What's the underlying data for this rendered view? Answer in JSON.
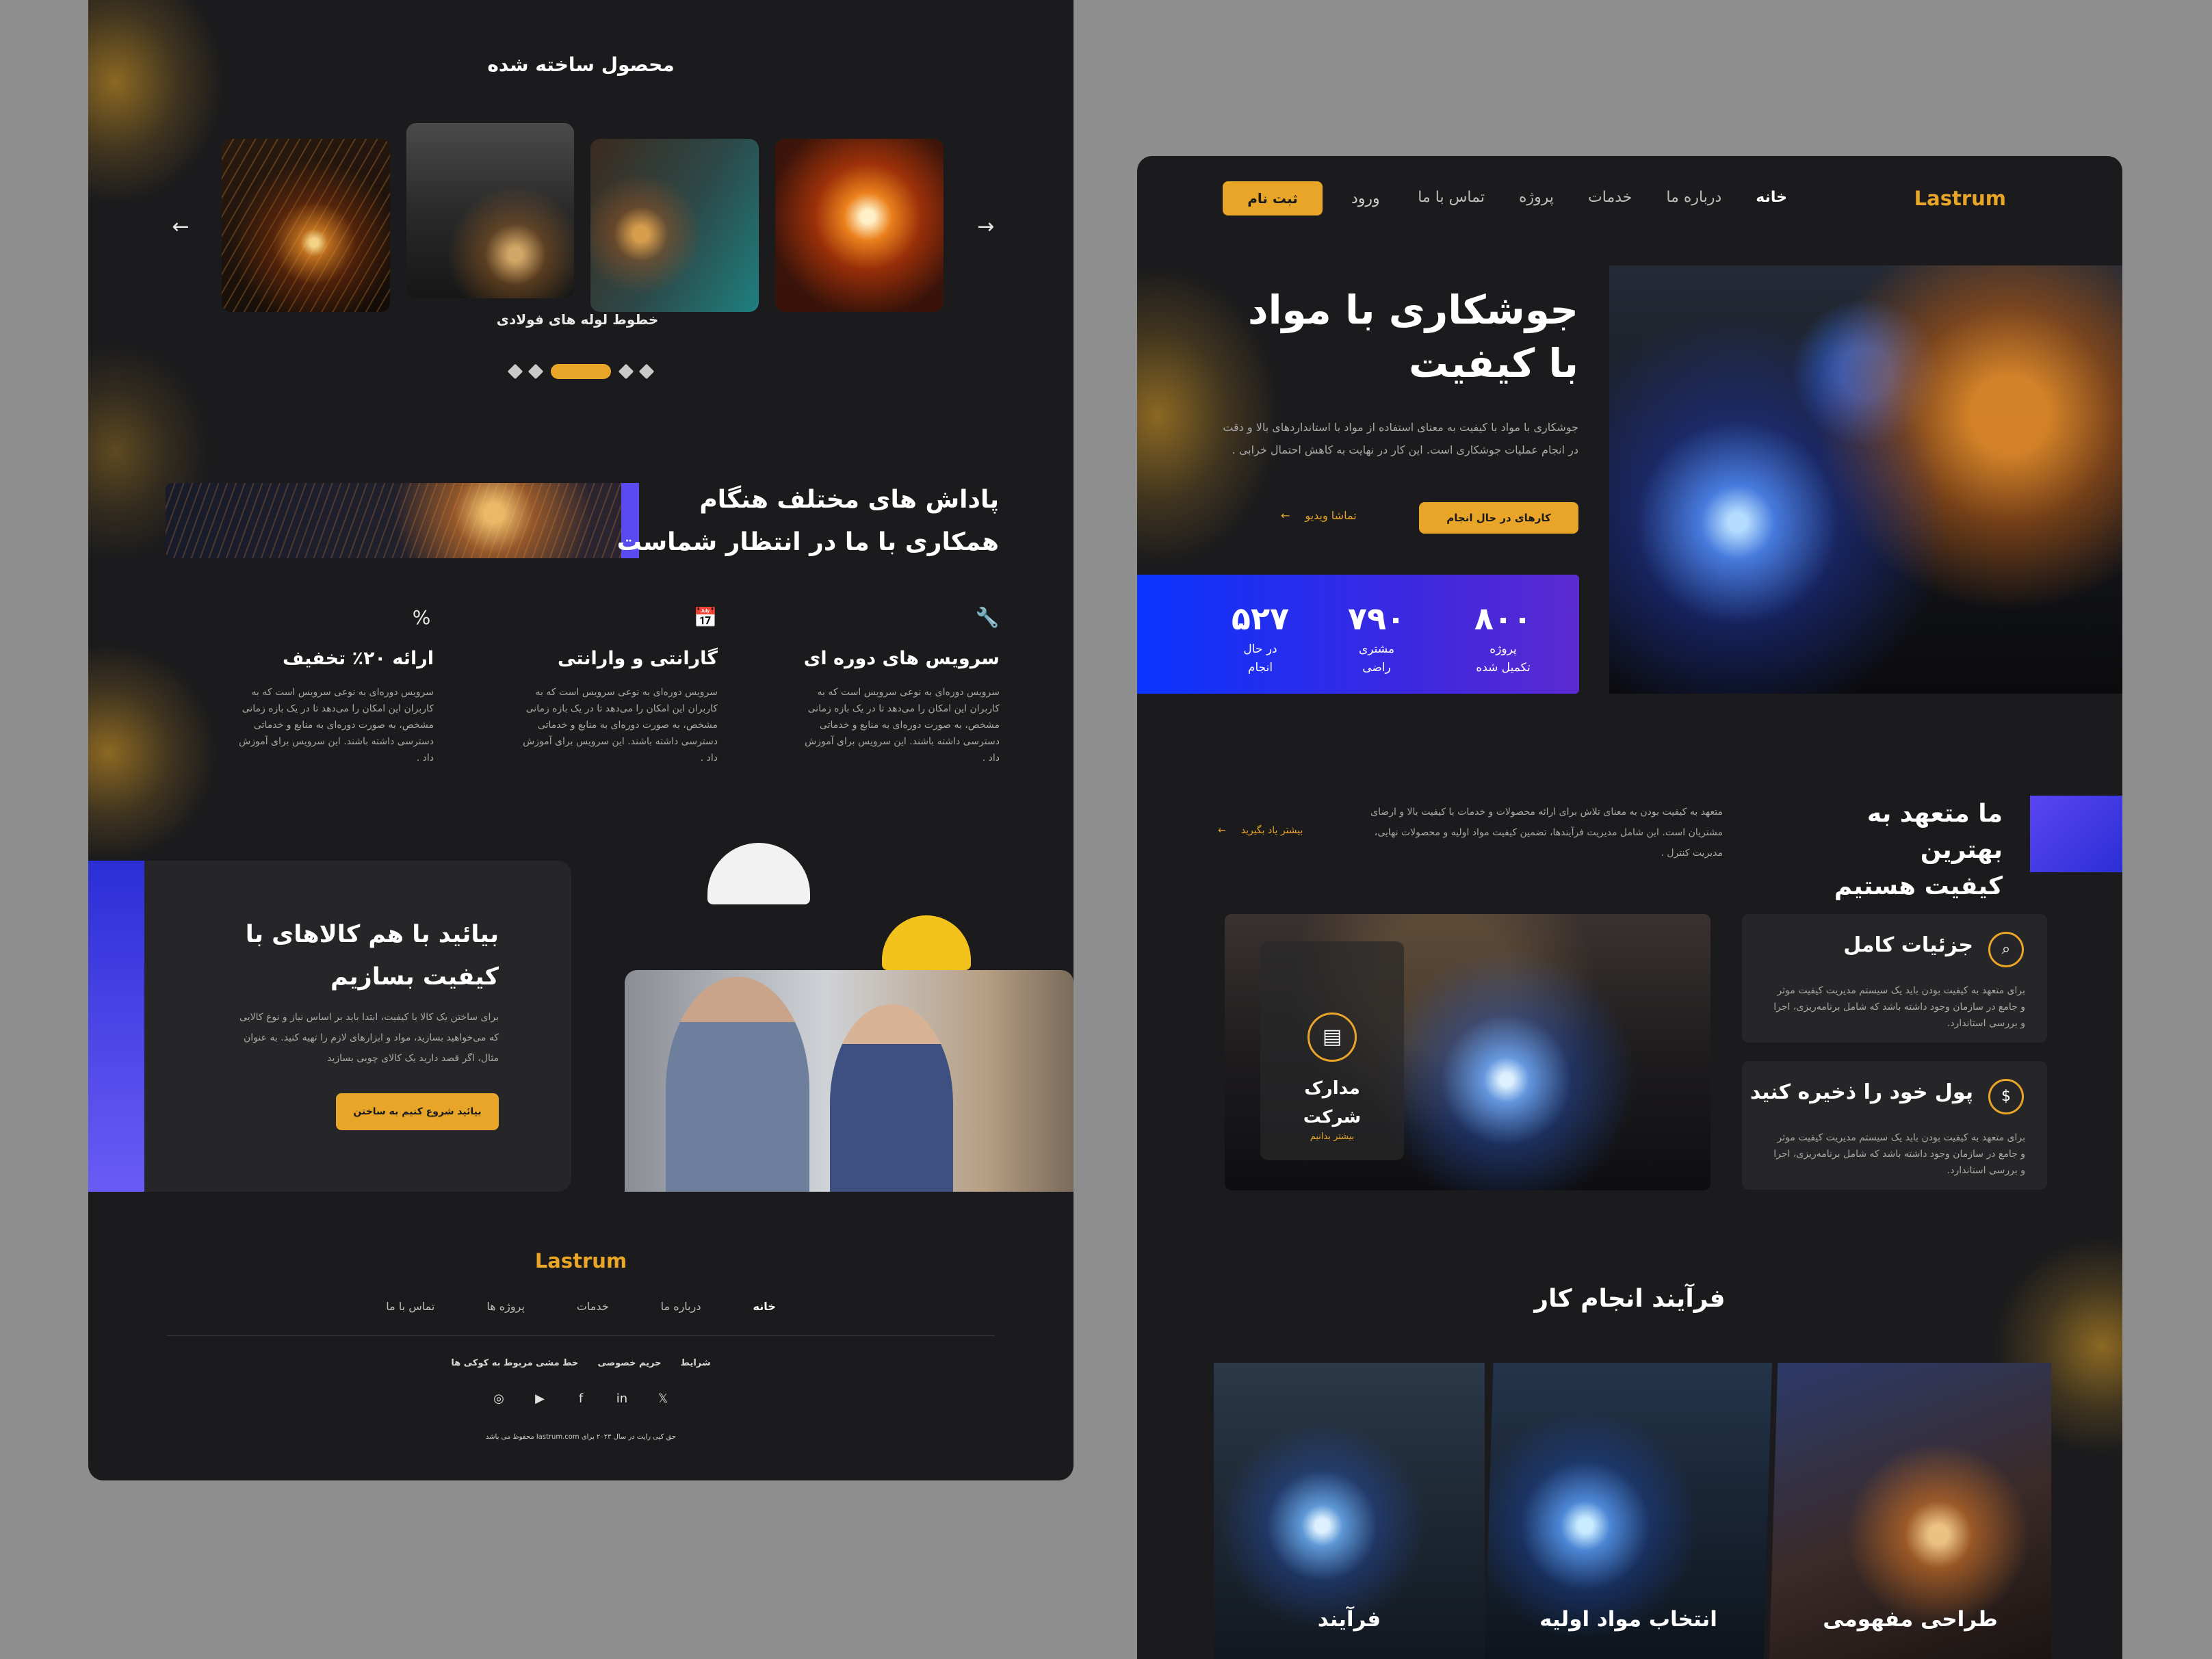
{
  "brand": {
    "name": "Lastrum",
    "accent": "#e8a528",
    "blue": "#0a34ff",
    "violet": "#5a4bf0",
    "bg_dark": "#1b1b1d"
  },
  "left": {
    "products_title": "محصول ساخته شده",
    "carousel": {
      "prev_icon": "arrow-left-icon",
      "next_icon": "arrow-right-icon",
      "featured_caption": "خطوط لوله های فولادی",
      "dots_count": 5,
      "active_dot": 3
    },
    "rewards": {
      "title_line1": "پاداش های مختلف هنگام",
      "title_line2": "همکاری با ما در انتظار شماست"
    },
    "features": [
      {
        "icon": "wrench-icon",
        "title": "سرویس های دوره ای",
        "desc": "سرویس دوره‌ای به نوعی سرویس است که به کاربران این امکان را می‌دهد تا در یک بازه زمانی مشخص، به صورت دوره‌ای به منابع و خدماتی دسترسی داشته باشند. این سرویس برای آموزش داد ."
      },
      {
        "icon": "calendar-icon",
        "title": "گارانتی و وارانتی",
        "desc": "سرویس دوره‌ای به نوعی سرویس است که به کاربران این امکان را می‌دهد تا در یک بازه زمانی مشخص، به صورت دوره‌ای به منابع و خدماتی دسترسی داشته باشند. این سرویس برای آموزش داد ."
      },
      {
        "icon": "percent-icon",
        "title": "ارائه ۲۰٪ تخفیف",
        "desc": "سرویس دوره‌ای به نوعی سرویس است که به کاربران این امکان را می‌دهد تا در یک بازه زمانی مشخص، به صورت دوره‌ای به منابع و خدماتی دسترسی داشته باشند. این سرویس برای آموزش داد ."
      }
    ],
    "cta": {
      "title_line1": "بیائید با هم کالاهای با",
      "title_line2": "کیفیت بسازیم",
      "desc": "برای ساختن یک کالا با کیفیت، ابتدا باید بر اساس نیاز و نوع کالایی که می‌خواهید بسازید، مواد و ابزارهای لازم را تهیه کنید. به عنوان مثال، اگر قصد دارید یک کالای چوبی بسازید",
      "button": "بیائید شروع کنیم به ساختن"
    },
    "footer": {
      "logo": "Lastrum",
      "nav": [
        "خانه",
        "درباره ما",
        "خدمات",
        "پروژه ها",
        "تماس با ما"
      ],
      "legal": [
        "شرایط",
        "حریم خصوصی",
        "خط مشی مربوط به کوکی ها"
      ],
      "social": [
        "twitter-icon",
        "linkedin-icon",
        "facebook-icon",
        "youtube-icon",
        "instagram-icon"
      ],
      "copyright": "حق کپی رایت در سال ۲۰۲۳ برای lastrum.com محفوظ می باشد"
    }
  },
  "right": {
    "nav": {
      "logo": "Lastrum",
      "items": [
        "خانه",
        "درباره ما",
        "خدمات",
        "پروژه",
        "تماس با ما"
      ],
      "login": "ورود",
      "signup": "ثبت نام"
    },
    "hero": {
      "title_line1": "جوشکاری با مواد",
      "title_line2": "با کیفیت",
      "desc": "جوشکاری با مواد با کیفیت به معنای استفاده از مواد با استانداردهای بالا و دقت در انجام عملیات جوشکاری است. این کار در نهایت به کاهش احتمال خرابی .",
      "primary_button": "کارهای در حال انجام",
      "video_link": "تماشا ویدیو"
    },
    "stats": [
      {
        "value": "۸۰۰",
        "label1": "پروژه",
        "label2": "تکمیل شده"
      },
      {
        "value": "۷۹۰",
        "label1": "مشتری",
        "label2": "راضی"
      },
      {
        "value": "۵۲۷",
        "label1": "در حال",
        "label2": "انجام"
      }
    ],
    "commitment": {
      "title_line1": "ما متعهد به بهترین",
      "title_line2": "کیفیت هستیم",
      "desc": "متعهد به کیفیت بودن به معنای تلاش برای ارائه محصولات و خدمات با کیفیت بالا و ارضای مشتریان است. این شامل مدیریت فرآیندها، تضمین کیفیت مواد اولیه و محصولات نهایی، مدیریت کنترل .",
      "link": "بیشتر یاد بگیرید"
    },
    "docs": {
      "title_line1": "مدارک",
      "title_line2": "شرکت",
      "link": "بیشتر بدانیم",
      "icon": "certificate-icon"
    },
    "cards": [
      {
        "icon": "search-icon",
        "title": "جزئیات کامل",
        "desc": "برای متعهد به کیفیت بودن باید یک سیستم مدیریت کیفیت موثر و جامع در سازمان وجود داشته باشد که شامل برنامه‌ریزی، اجرا و بررسی استاندارد."
      },
      {
        "icon": "money-bag-icon",
        "title": "پول خود را ذخیره کنید",
        "desc": "برای متعهد به کیفیت بودن باید یک سیستم مدیریت کیفیت موثر و جامع در سازمان وجود داشته باشد که شامل برنامه‌ریزی، اجرا و بررسی استاندارد."
      }
    ],
    "process": {
      "title": "فرآیند انجام کار",
      "steps": [
        "فرآیند",
        "انتخاب مواد اولیه",
        "طراحی مفهومی"
      ]
    }
  }
}
